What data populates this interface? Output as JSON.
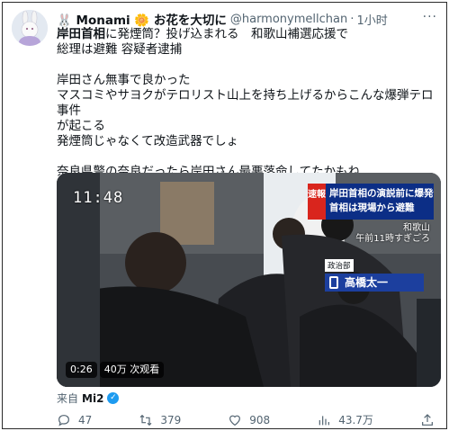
{
  "tweet": {
    "author_name": "Monami",
    "name_decorations": "お花を大切に",
    "handle": "@harmonymellchan",
    "separator": "·",
    "time": "1小时",
    "more": "···",
    "text_lines": [
      "岸田首相に発煙筒？投げ込まれる　和歌山補選応援で",
      "総理は避難 容疑者逮捕",
      "",
      "岸田さん無事で良かった",
      "マスコミやサヨクがテロリスト山上を持ち上げるからこんな爆弾テロ事件",
      "が起こる",
      "発煙筒じゃなくて改造武器でしょ",
      "",
      "奈良県警の奈良だったら岸田さん最悪落命してたかもね"
    ],
    "source_prefix": "来自",
    "source_app": "Mi2"
  },
  "video": {
    "clock": "11:48",
    "breaking_tag": "速報",
    "breaking_line1": "岸田首相の演説前に爆発音",
    "breaking_line2": "首相は現場から避難",
    "location": "和歌山",
    "location_time": "午前11時すぎごろ",
    "reporter_dept": "政治部",
    "reporter_name": "高橋太一",
    "duration": "0:26",
    "views": "40万 次观看"
  },
  "actions": {
    "replies": "47",
    "retweets": "379",
    "likes": "908",
    "views": "43.7万"
  }
}
